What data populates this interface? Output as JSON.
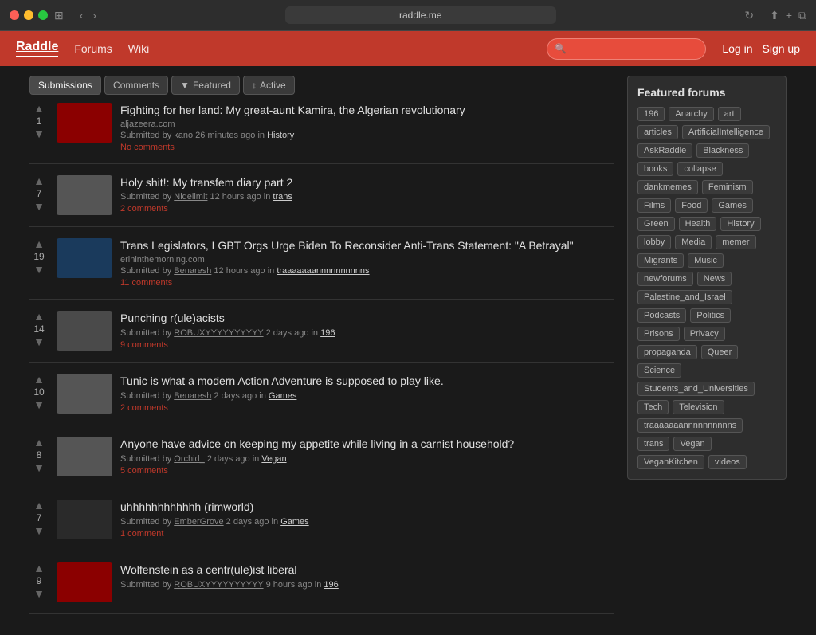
{
  "browser": {
    "url": "raddle.me",
    "security_icon": "🔒",
    "refresh_icon": "↻"
  },
  "navbar": {
    "logo": "Raddle",
    "links": [
      "Forums",
      "Wiki"
    ],
    "search_placeholder": "",
    "login": "Log in",
    "signup": "Sign up"
  },
  "tabs": {
    "submissions_label": "Submissions",
    "comments_label": "Comments",
    "featured_label": "Featured",
    "active_label": "Active"
  },
  "posts": [
    {
      "id": 1,
      "votes": 1,
      "title": "Fighting for her land: My great-aunt Kamira, the Algerian revolutionary",
      "source": "aljazeera.com",
      "submitted_by": "kano",
      "time_ago": "26 minutes ago",
      "forum": "History",
      "comments_text": "No comments",
      "comments_count": 0,
      "has_thumb": true,
      "thumb_color": "thumb-red"
    },
    {
      "id": 2,
      "votes": 7,
      "title": "Holy shit!: My transfem diary part 2",
      "source": "",
      "submitted_by": "Nidelimit",
      "time_ago": "12 hours ago",
      "forum": "trans",
      "comments_text": "2 comments",
      "comments_count": 2,
      "has_thumb": false,
      "thumb_color": ""
    },
    {
      "id": 3,
      "votes": 19,
      "title": "Trans Legislators, LGBT Orgs Urge Biden To Reconsider Anti-Trans Statement: \"A Betrayal\"",
      "source": "erininthemorning.com",
      "submitted_by": "Benaresh",
      "time_ago": "12 hours ago",
      "forum": "traaaaaaannnnnnnnnns",
      "comments_text": "11 comments",
      "comments_count": 11,
      "has_thumb": true,
      "thumb_color": "thumb-blue"
    },
    {
      "id": 4,
      "votes": 14,
      "title": "Punching r(ule)acists",
      "source": "",
      "submitted_by": "ROBUXYYYYYYYYYY",
      "time_ago": "2 days ago",
      "forum": "196",
      "comments_text": "9 comments",
      "comments_count": 9,
      "has_thumb": true,
      "thumb_color": "thumb-gray"
    },
    {
      "id": 5,
      "votes": 10,
      "title": "Tunic is what a modern Action Adventure is supposed to play like.",
      "source": "",
      "submitted_by": "Benaresh",
      "time_ago": "2 days ago",
      "forum": "Games",
      "comments_text": "2 comments",
      "comments_count": 2,
      "has_thumb": false,
      "thumb_color": ""
    },
    {
      "id": 6,
      "votes": 8,
      "title": "Anyone have advice on keeping my appetite while living in a carnist household?",
      "source": "",
      "submitted_by": "Orchid_",
      "time_ago": "2 days ago",
      "forum": "Vegan",
      "comments_text": "5 comments",
      "comments_count": 5,
      "has_thumb": false,
      "thumb_color": ""
    },
    {
      "id": 7,
      "votes": 7,
      "title": "uhhhhhhhhhhhh (rimworld)",
      "source": "",
      "submitted_by": "EmberGrove",
      "time_ago": "2 days ago",
      "forum": "Games",
      "comments_text": "1 comment",
      "comments_count": 1,
      "has_thumb": true,
      "thumb_color": "thumb-dark"
    },
    {
      "id": 8,
      "votes": 9,
      "title": "Wolfenstein as a centr(ule)ist liberal",
      "source": "",
      "submitted_by": "ROBUXYYYYYYYYYY",
      "time_ago": "9 hours ago",
      "forum": "196",
      "comments_text": "",
      "comments_count": 0,
      "has_thumb": true,
      "thumb_color": "thumb-red"
    }
  ],
  "sidebar": {
    "title": "Featured forums",
    "tags": [
      "196",
      "Anarchy",
      "art",
      "articles",
      "ArtificialIntelligence",
      "AskRaddle",
      "Blackness",
      "books",
      "collapse",
      "dankmemes",
      "Feminism",
      "Films",
      "Food",
      "Games",
      "Green",
      "Health",
      "History",
      "lobby",
      "Media",
      "memer",
      "Migrants",
      "Music",
      "newforums",
      "News",
      "Palestine_and_Israel",
      "Podcasts",
      "Politics",
      "Prisons",
      "Privacy",
      "propaganda",
      "Queer",
      "Science",
      "Students_and_Universities",
      "Tech",
      "Television",
      "traaaaaaannnnnnnnnns",
      "trans",
      "Vegan",
      "VeganKitchen",
      "videos"
    ]
  }
}
